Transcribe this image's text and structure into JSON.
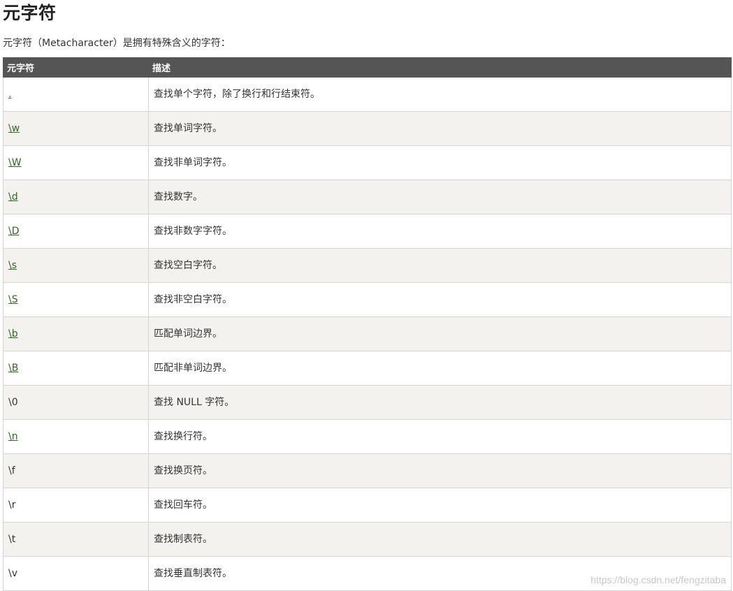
{
  "title": "元字符",
  "intro": "元字符（Metacharacter）是拥有特殊含义的字符：",
  "table": {
    "headers": [
      "元字符",
      "描述"
    ],
    "rows": [
      {
        "meta": ".",
        "desc": "查找单个字符，除了换行和行结束符。",
        "link": true
      },
      {
        "meta": "\\w",
        "desc": "查找单词字符。",
        "link": true
      },
      {
        "meta": "\\W",
        "desc": "查找非单词字符。",
        "link": true
      },
      {
        "meta": "\\d",
        "desc": "查找数字。",
        "link": true
      },
      {
        "meta": "\\D",
        "desc": "查找非数字字符。",
        "link": true
      },
      {
        "meta": "\\s",
        "desc": "查找空白字符。",
        "link": true
      },
      {
        "meta": "\\S",
        "desc": "查找非空白字符。",
        "link": true
      },
      {
        "meta": "\\b",
        "desc": "匹配单词边界。",
        "link": true
      },
      {
        "meta": "\\B",
        "desc": "匹配非单词边界。",
        "link": true
      },
      {
        "meta": "\\0",
        "desc": "查找 NULL 字符。",
        "link": false
      },
      {
        "meta": "\\n",
        "desc": "查找换行符。",
        "link": true
      },
      {
        "meta": "\\f",
        "desc": "查找换页符。",
        "link": false
      },
      {
        "meta": "\\r",
        "desc": "查找回车符。",
        "link": false
      },
      {
        "meta": "\\t",
        "desc": "查找制表符。",
        "link": false
      },
      {
        "meta": "\\v",
        "desc": "查找垂直制表符。",
        "link": false
      }
    ]
  },
  "watermark": "https://blog.csdn.net/fengzitaba",
  "colors": {
    "header_bg": "#555555",
    "link": "#2c6a1e",
    "stripe": "#f3f2ee"
  }
}
